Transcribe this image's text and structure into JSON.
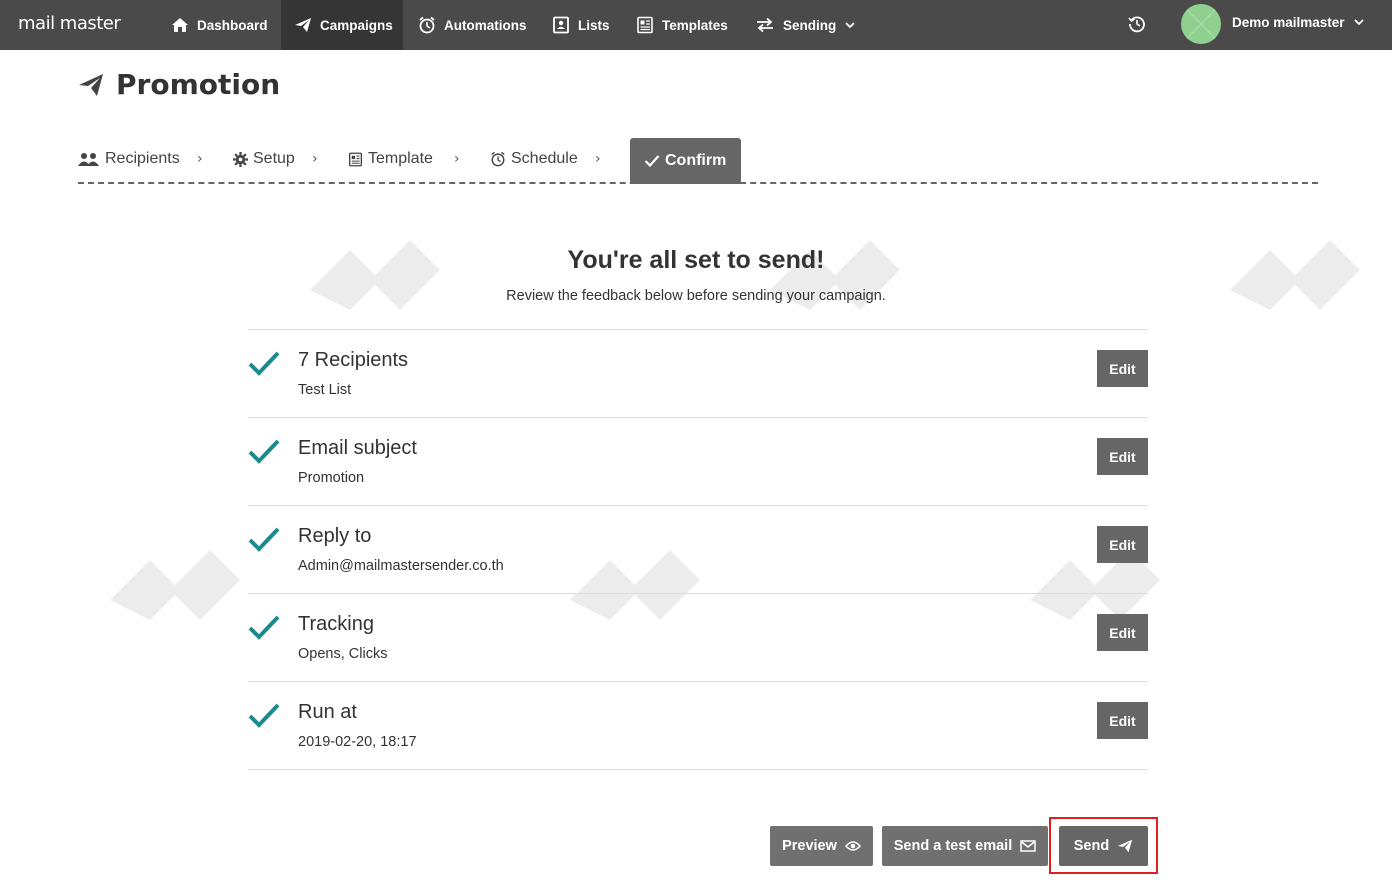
{
  "app": {
    "logo": "mail master"
  },
  "nav": {
    "items": [
      {
        "label": "Dashboard",
        "icon": "home-icon"
      },
      {
        "label": "Campaigns",
        "icon": "paper-plane-icon",
        "active": true
      },
      {
        "label": "Automations",
        "icon": "alarm-clock-icon"
      },
      {
        "label": "Lists",
        "icon": "address-book-icon"
      },
      {
        "label": "Templates",
        "icon": "newspaper-icon"
      },
      {
        "label": "Sending",
        "icon": "exchange-icon",
        "dropdown": true
      }
    ],
    "user": {
      "name": "Demo mailmaster"
    }
  },
  "page": {
    "title": "Promotion"
  },
  "steps": [
    {
      "label": "Recipients",
      "icon": "users-icon"
    },
    {
      "label": "Setup",
      "icon": "gear-icon"
    },
    {
      "label": "Template",
      "icon": "newspaper-icon"
    },
    {
      "label": "Schedule",
      "icon": "alarm-clock-icon"
    },
    {
      "label": "Confirm",
      "icon": "check-icon",
      "active": true
    }
  ],
  "confirm": {
    "title": "You're all set to send!",
    "subtitle": "Review the feedback below before sending your campaign."
  },
  "summary": [
    {
      "title": "7 Recipients",
      "value": "Test List",
      "action": "Edit"
    },
    {
      "title": "Email subject",
      "value": "Promotion",
      "action": "Edit"
    },
    {
      "title": "Reply to",
      "value": "Admin@mailmastersender.co.th",
      "action": "Edit"
    },
    {
      "title": "Tracking",
      "value": "Opens, Clicks",
      "action": "Edit"
    },
    {
      "title": "Run at",
      "value": "2019-02-20, 18:17",
      "action": "Edit"
    }
  ],
  "actions": {
    "preview": "Preview",
    "test": "Send a test email",
    "send": "Send"
  },
  "colors": {
    "topbar": "#4a4a4a",
    "check": "#1a8a8f",
    "button": "#666666",
    "highlight": "#e02020"
  }
}
